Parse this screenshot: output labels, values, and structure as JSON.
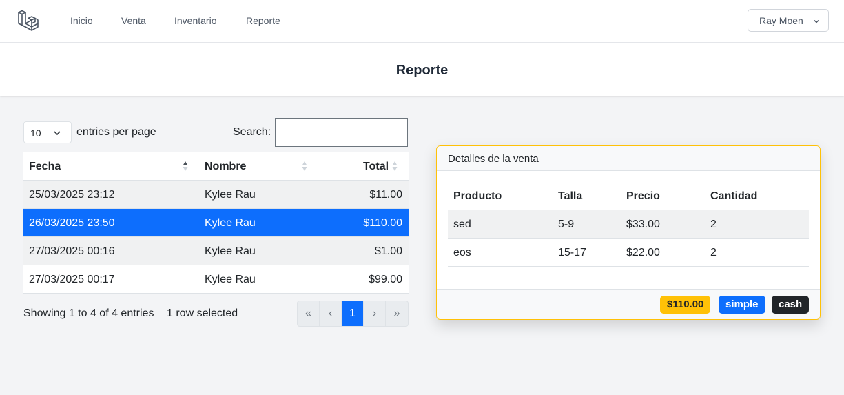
{
  "nav": {
    "links": [
      "Inicio",
      "Venta",
      "Inventario",
      "Reporte"
    ],
    "user": "Ray Moen"
  },
  "page": {
    "title": "Reporte"
  },
  "table_controls": {
    "per_page_value": "10",
    "per_page_label": "entries per page",
    "search_label": "Search:",
    "search_value": ""
  },
  "sales_table": {
    "columns": [
      "Fecha",
      "Nombre",
      "Total"
    ],
    "rows": [
      {
        "fecha": "25/03/2025 23:12",
        "nombre": "Kylee Rau",
        "total": "$11.00"
      },
      {
        "fecha": "26/03/2025 23:50",
        "nombre": "Kylee Rau",
        "total": "$110.00"
      },
      {
        "fecha": "27/03/2025 00:16",
        "nombre": "Kylee Rau",
        "total": "$1.00"
      },
      {
        "fecha": "27/03/2025 00:17",
        "nombre": "Kylee Rau",
        "total": "$99.00"
      }
    ],
    "selected_row": 1,
    "info": "Showing 1 to 4 of 4 entries",
    "selected_info": "1 row selected",
    "pagination": [
      "«",
      "‹",
      "1",
      "›",
      "»"
    ],
    "current_page": "1"
  },
  "details": {
    "title": "Detalles de la venta",
    "columns": [
      "Producto",
      "Talla",
      "Precio",
      "Cantidad"
    ],
    "rows": [
      {
        "producto": "sed",
        "talla": "5-9",
        "precio": "$33.00",
        "cantidad": "2"
      },
      {
        "producto": "eos",
        "talla": "15-17",
        "precio": "$22.00",
        "cantidad": "2"
      }
    ],
    "badges": {
      "total": "$110.00",
      "type": "simple",
      "payment": "cash"
    }
  },
  "colors": {
    "primary": "#0d6efd",
    "warning": "#ffc107",
    "dark": "#212529"
  }
}
